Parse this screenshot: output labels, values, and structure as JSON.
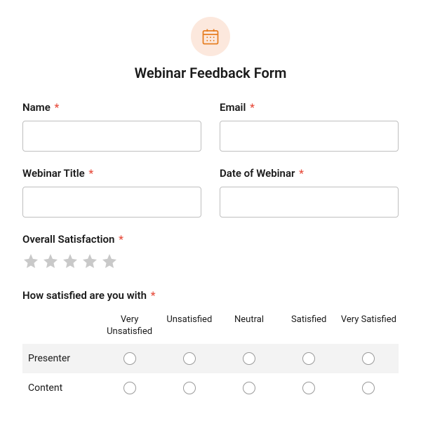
{
  "title": "Webinar Feedback Form",
  "required_marker": "*",
  "fields": {
    "name": {
      "label": "Name",
      "value": ""
    },
    "email": {
      "label": "Email",
      "value": ""
    },
    "webinar_title": {
      "label": "Webinar Title",
      "value": ""
    },
    "date": {
      "label": "Date of Webinar",
      "value": ""
    }
  },
  "satisfaction_label": "Overall Satisfaction",
  "matrix_label": "How satisfied are you with",
  "matrix_cols": [
    "Very Unsatisfied",
    "Unsatisfied",
    "Neutral",
    "Satisfied",
    "Very Satisfied"
  ],
  "matrix_rows": [
    "Presenter",
    "Content"
  ]
}
